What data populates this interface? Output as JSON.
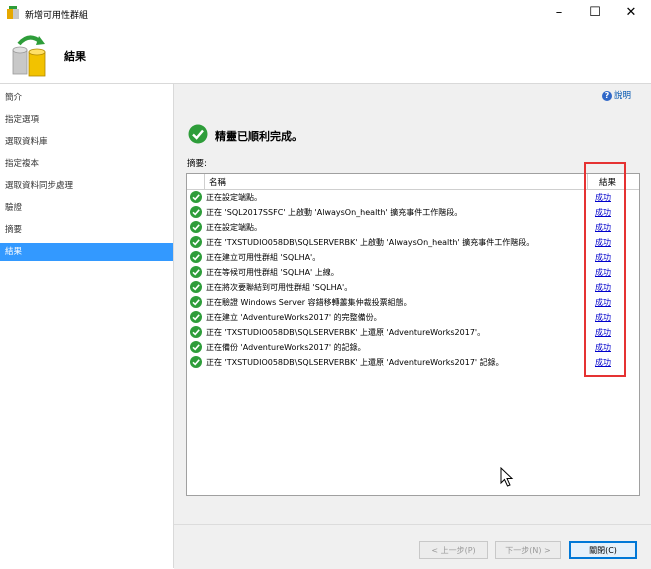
{
  "window": {
    "title": "新增可用性群組",
    "minimize": "–",
    "maximize": "☐",
    "close": "✕"
  },
  "header": {
    "title": "結果"
  },
  "sidebar": {
    "items": [
      {
        "label": "簡介",
        "active": false
      },
      {
        "label": "指定選項",
        "active": false
      },
      {
        "label": "選取資料庫",
        "active": false
      },
      {
        "label": "指定複本",
        "active": false
      },
      {
        "label": "選取資料同步處理",
        "active": false
      },
      {
        "label": "驗證",
        "active": false
      },
      {
        "label": "摘要",
        "active": false
      },
      {
        "label": "結果",
        "active": true
      }
    ]
  },
  "main": {
    "help": "說明",
    "success_message": "精靈已順利完成。",
    "summary_label": "摘要:",
    "table": {
      "columns": [
        "名稱",
        "結果"
      ],
      "rows": [
        {
          "name": "正在設定端點。",
          "result": "成功"
        },
        {
          "name": "正在 'SQL2017SSFC' 上啟動 'AlwaysOn_health' 擴充事件工作階段。",
          "result": "成功"
        },
        {
          "name": "正在設定端點。",
          "result": "成功"
        },
        {
          "name": "正在 'TXSTUDIO058DB\\SQLSERVERBK' 上啟動 'AlwaysOn_health' 擴充事件工作階段。",
          "result": "成功"
        },
        {
          "name": "正在建立可用性群組 'SQLHA'。",
          "result": "成功"
        },
        {
          "name": "正在等候可用性群組 'SQLHA' 上線。",
          "result": "成功"
        },
        {
          "name": "正在將次要聯結到可用性群組 'SQLHA'。",
          "result": "成功"
        },
        {
          "name": "正在驗證 Windows Server 容錯移轉叢集仲裁投票組態。",
          "result": "成功"
        },
        {
          "name": "正在建立 'AdventureWorks2017' 的完整備份。",
          "result": "成功"
        },
        {
          "name": "正在 'TXSTUDIO058DB\\SQLSERVERBK' 上還原 'AdventureWorks2017'。",
          "result": "成功"
        },
        {
          "name": "正在備份 'AdventureWorks2017' 的記錄。",
          "result": "成功"
        },
        {
          "name": "正在 'TXSTUDIO058DB\\SQLSERVERBK' 上還原 'AdventureWorks2017' 記錄。",
          "result": "成功"
        }
      ]
    }
  },
  "buttons": {
    "prev": "< 上一步(P)",
    "next": "下一步(N) >",
    "close": "關閉(C)"
  },
  "colors": {
    "accent": "#3399ff",
    "success": "#2e9d3a",
    "highlight_box": "#e53232",
    "link": "#0000cc"
  }
}
